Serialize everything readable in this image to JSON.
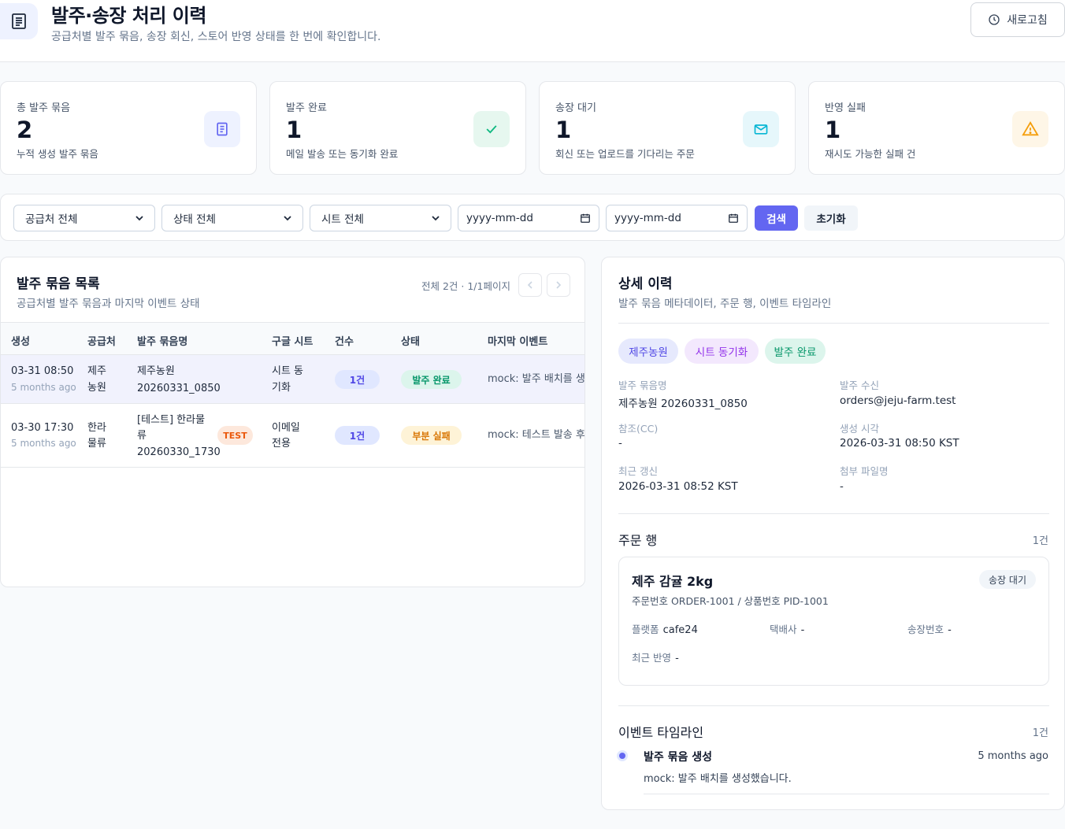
{
  "header": {
    "title": "발주·송장 처리 이력",
    "subtitle": "공급처별 발주 묶음, 송장 회신, 스토어 반영 상태를 한 번에 확인합니다.",
    "refresh_label": "새로고침"
  },
  "stats": [
    {
      "label": "총 발주 묶음",
      "value": "2",
      "desc": "누적 생성 발주 묶음",
      "icon": "receipt-icon",
      "color": "#6366f1",
      "bg": "#eef2ff"
    },
    {
      "label": "발주 완료",
      "value": "1",
      "desc": "메일 발송 또는 동기화 완료",
      "icon": "check-icon",
      "color": "#10b981",
      "bg": "#e6f7ef"
    },
    {
      "label": "송장 대기",
      "value": "1",
      "desc": "회신 또는 업로드를 기다리는 주문",
      "icon": "mail-icon",
      "color": "#06b6d4",
      "bg": "#e6f7fb"
    },
    {
      "label": "반영 실패",
      "value": "1",
      "desc": "재시도 가능한 실패 건",
      "icon": "warning-icon",
      "color": "#f59e0b",
      "bg": "#fef6e7"
    }
  ],
  "filters": {
    "supplier": "공급처 전체",
    "status": "상태 전체",
    "sheet": "시트 전체",
    "date_from": "yyyy-mm-dd",
    "date_to": "yyyy-mm-dd",
    "search_label": "검색",
    "reset_label": "초기화"
  },
  "list": {
    "title": "발주 묶음 목록",
    "subtitle": "공급처별 발주 묶음과 마지막 이벤트 상태",
    "pager": "전체 2건 · 1/1페이지",
    "columns": [
      "생성",
      "공급처",
      "발주 묶음명",
      "구글 시트",
      "건수",
      "상태",
      "마지막 이벤트"
    ],
    "rows": [
      {
        "date": "03-31 08:50",
        "ago": "5 months ago",
        "supplier_l1": "제주",
        "supplier_l2": "농원",
        "batch_l1": "제주농원",
        "batch_l2": "20260331_0850",
        "batch_l3": "",
        "test": "",
        "sheet_l1": "시트 동",
        "sheet_l2": "기화",
        "count": "1건",
        "status": "발주 완료",
        "status_color": "#059669",
        "status_bg": "#dcf5ec",
        "event": "mock: 발주 배치를 생성했습니다."
      },
      {
        "date": "03-30 17:30",
        "ago": "5 months ago",
        "supplier_l1": "한라",
        "supplier_l2": "물류",
        "batch_l1": "[테스트] 한라물",
        "batch_l2": "류",
        "batch_l3": "20260330_1730",
        "test": "TEST",
        "sheet_l1": "이메일",
        "sheet_l2": "전용",
        "count": "1건",
        "status": "부분 실패",
        "status_color": "#d97706",
        "status_bg": "#fef3d7",
        "event": "mock: 테스트 발송 후 일부 반영 실패"
      }
    ]
  },
  "detail": {
    "title": "상세 이력",
    "subtitle": "발주 묶음 메타데이터, 주문 행, 이벤트 타임라인",
    "tags": [
      "제주농원",
      "시트 동기화",
      "발주 완료"
    ],
    "meta": {
      "batch_label": "발주 묶음명",
      "batch_value": "제주농원 20260331_0850",
      "recipient_label": "발주 수신",
      "recipient_value": "orders@jeju-farm.test",
      "cc_label": "참조(CC)",
      "cc_value": "-",
      "created_label": "생성 시각",
      "created_value": "2026-03-31 08:50 KST",
      "updated_label": "최근 갱신",
      "updated_value": "2026-03-31 08:52 KST",
      "attach_label": "첨부 파일명",
      "attach_value": "-"
    },
    "orders": {
      "title": "주문 행",
      "count": "1건",
      "item": {
        "name": "제주 감귤 2kg",
        "badge": "송장 대기",
        "ids": "주문번호 ORDER-1001 / 상품번호 PID-1001",
        "platform_label": "플랫폼",
        "platform_value": "cafe24",
        "courier_label": "택배사",
        "courier_value": "-",
        "tracking_label": "송장번호",
        "tracking_value": "-",
        "reflect_label": "최근 반영",
        "reflect_value": "-"
      }
    },
    "timeline": {
      "title": "이벤트 타임라인",
      "count": "1건",
      "events": [
        {
          "title": "발주 묶음 생성",
          "time": "5 months ago",
          "desc": "mock: 발주 배치를 생성했습니다."
        }
      ]
    }
  }
}
